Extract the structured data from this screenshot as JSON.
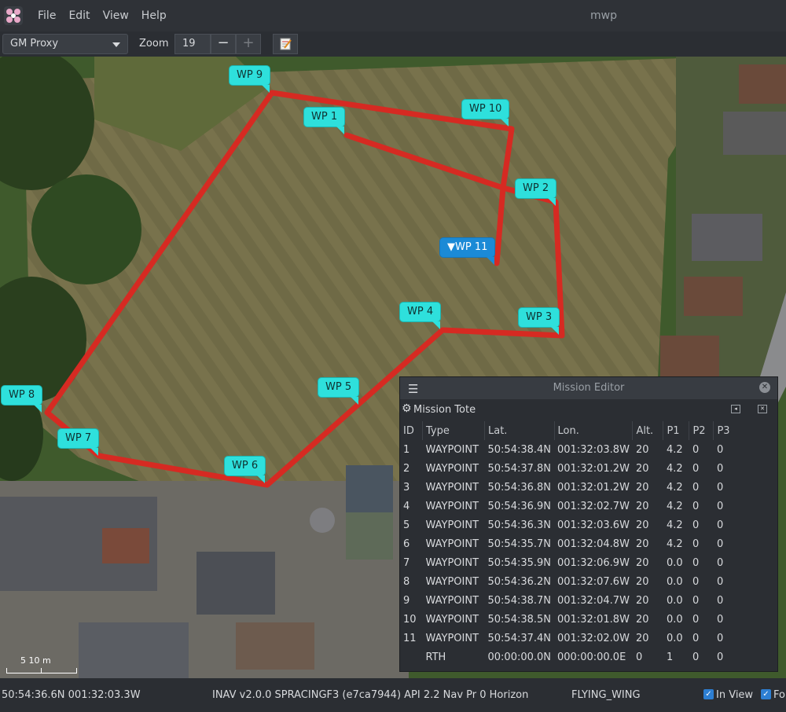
{
  "app": {
    "title": "mwp",
    "menu": [
      "File",
      "Edit",
      "View",
      "Help"
    ]
  },
  "toolbar": {
    "map_source": "GM Proxy",
    "zoom_label": "Zoom",
    "zoom_value": "19",
    "zoom_out": "−",
    "zoom_in": "+"
  },
  "map": {
    "waypoint_labels": [
      "WP 1",
      "WP 2",
      "WP 3",
      "WP 4",
      "WP 5",
      "WP 6",
      "WP 7",
      "WP 8",
      "WP 9",
      "WP 10",
      "WP 11"
    ],
    "current_label": "▼WP 11",
    "scale_label": "5   10 m",
    "route_color": "#d62a22",
    "marker_color": "#2ee0dc",
    "current_marker_color": "#1b8ad6"
  },
  "editor": {
    "title": "Mission Editor",
    "subtitle": "Mission Tote",
    "columns": [
      "ID",
      "Type",
      "Lat.",
      "Lon.",
      "Alt.",
      "P1",
      "P2",
      "P3"
    ],
    "rows": [
      [
        "1",
        "WAYPOINT",
        "50:54:38.4N",
        "001:32:03.8W",
        "20",
        "4.2",
        "0",
        "0"
      ],
      [
        "2",
        "WAYPOINT",
        "50:54:37.8N",
        "001:32:01.2W",
        "20",
        "4.2",
        "0",
        "0"
      ],
      [
        "3",
        "WAYPOINT",
        "50:54:36.8N",
        "001:32:01.2W",
        "20",
        "4.2",
        "0",
        "0"
      ],
      [
        "4",
        "WAYPOINT",
        "50:54:36.9N",
        "001:32:02.7W",
        "20",
        "4.2",
        "0",
        "0"
      ],
      [
        "5",
        "WAYPOINT",
        "50:54:36.3N",
        "001:32:03.6W",
        "20",
        "4.2",
        "0",
        "0"
      ],
      [
        "6",
        "WAYPOINT",
        "50:54:35.7N",
        "001:32:04.8W",
        "20",
        "4.2",
        "0",
        "0"
      ],
      [
        "7",
        "WAYPOINT",
        "50:54:35.9N",
        "001:32:06.9W",
        "20",
        "0.0",
        "0",
        "0"
      ],
      [
        "8",
        "WAYPOINT",
        "50:54:36.2N",
        "001:32:07.6W",
        "20",
        "0.0",
        "0",
        "0"
      ],
      [
        "9",
        "WAYPOINT",
        "50:54:38.7N",
        "001:32:04.7W",
        "20",
        "0.0",
        "0",
        "0"
      ],
      [
        "10",
        "WAYPOINT",
        "50:54:38.5N",
        "001:32:01.8W",
        "20",
        "0.0",
        "0",
        "0"
      ],
      [
        "11",
        "WAYPOINT",
        "50:54:37.4N",
        "001:32:02.0W",
        "20",
        "0.0",
        "0",
        "0"
      ],
      [
        "",
        "RTH",
        "00:00:00.0N",
        "000:00:00.0E",
        "0",
        "1",
        "0",
        "0"
      ]
    ]
  },
  "status": {
    "position": "50:54:36.6N 001:32:03.3W",
    "fc_info": "INAV v2.0.0  SPRACINGF3 (e7ca7944) API 2.2 Nav Pr 0 Horizon",
    "model_type": "FLYING_WING",
    "in_view_label": "In View",
    "follow_label": "Fol"
  }
}
